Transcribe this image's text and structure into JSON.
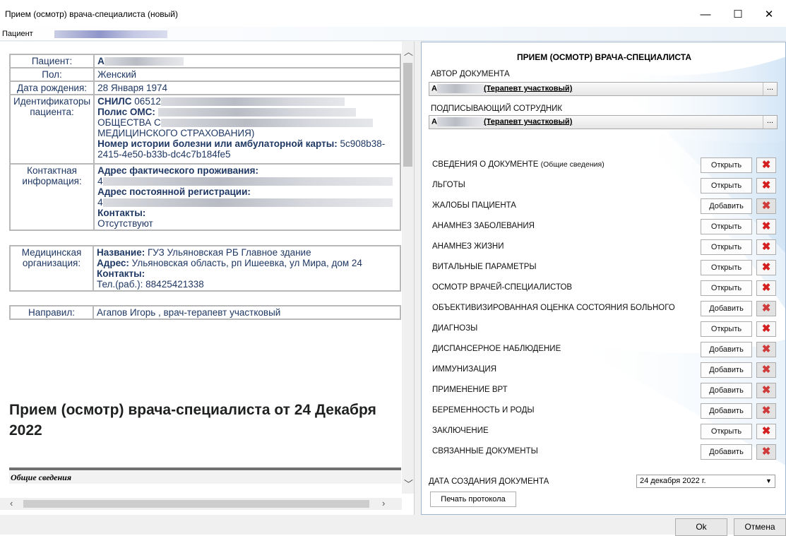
{
  "window": {
    "title": "Прием (осмотр) врача-специалиста (новый)",
    "minimize": "—",
    "maximize": "☐",
    "close": "✕"
  },
  "menu": {
    "patient": "Пациент"
  },
  "patient": {
    "labels": {
      "patient": "Пациент:",
      "sex": "Пол:",
      "dob": "Дата рождения:",
      "ids": "Идентификаторы пациента:",
      "contact": "Контактная информация:"
    },
    "sex": "Женский",
    "dob": "28 Января 1974",
    "snils_label": "СНИЛС",
    "snils_value": "06512",
    "oms_label": "Полис ОМС:",
    "oms_text1": "ОБЩЕСТВА С",
    "oms_text2": "МЕДИЦИНСКОГО СТРАХОВАНИЯ)",
    "history_label": "Номер истории болезни или амбулаторной карты:",
    "history_value1": "5c908b38-",
    "history_value2": "2415-4e50-b33b-dc4c7b184fe5",
    "fact_addr_label": "Адрес фактического проживания:",
    "reg_addr_label": "Адрес постоянной регистрации:",
    "contacts_label": "Контакты:",
    "contacts_value": "Отсутствуют",
    "initial": "А",
    "addr_initial": "4"
  },
  "organization": {
    "label": "Медицинская организация:",
    "name_label": "Название:",
    "name_value": "ГУЗ Ульяновская РБ Главное здание",
    "addr_label": "Адрес:",
    "addr_value": "Ульяновская область, рп Ишеевка, ул Мира, дом 24",
    "contacts_label": "Контакты:",
    "phone": "Тел.(раб.): 88425421338"
  },
  "referral": {
    "label": "Направил:",
    "value": "Агапов Игорь , врач-терапевт участковый"
  },
  "doc_heading": "Прием (осмотр) врача-специалиста от 24 Декабря 2022",
  "section_title": "Общие сведения",
  "panel": {
    "title": "ПРИЕМ (ОСМОТР) ВРАЧА-СПЕЦИАЛИСТА",
    "author_label": "АВТОР ДОКУМЕНТА",
    "author_role": "(Терапевт участковый)",
    "signer_label": "ПОДПИСЫВАЮЩИЙ СОТРУДНИК",
    "signer_role": "(Терапевт участковый)",
    "initial": "А",
    "dots": "...",
    "rows": [
      {
        "label": "СВЕДЕНИЯ О ДОКУМЕНТЕ",
        "note": "(Общие сведения)",
        "action": "Открыть",
        "enabled": true
      },
      {
        "label": "ЛЬГОТЫ",
        "note": "",
        "action": "Открыть",
        "enabled": true
      },
      {
        "label": "ЖАЛОБЫ ПАЦИЕНТА",
        "note": "",
        "action": "Добавить",
        "enabled": false
      },
      {
        "label": "АНАМНЕЗ ЗАБОЛЕВАНИЯ",
        "note": "",
        "action": "Открыть",
        "enabled": true
      },
      {
        "label": "АНАМНЕЗ ЖИЗНИ",
        "note": "",
        "action": "Открыть",
        "enabled": true
      },
      {
        "label": "ВИТАЛЬНЫЕ ПАРАМЕТРЫ",
        "note": "",
        "action": "Открыть",
        "enabled": true
      },
      {
        "label": "ОСМОТР ВРАЧЕЙ-СПЕЦИАЛИСТОВ",
        "note": "",
        "action": "Открыть",
        "enabled": true
      },
      {
        "label": "ОБЪЕКТИВИЗИРОВАННАЯ ОЦЕНКА СОСТОЯНИЯ БОЛЬНОГО",
        "note": "",
        "action": "Добавить",
        "enabled": false
      },
      {
        "label": "ДИАГНОЗЫ",
        "note": "",
        "action": "Открыть",
        "enabled": true
      },
      {
        "label": "ДИСПАНСЕРНОЕ НАБЛЮДЕНИЕ",
        "note": "",
        "action": "Добавить",
        "enabled": false
      },
      {
        "label": "ИММУНИЗАЦИЯ",
        "note": "",
        "action": "Добавить",
        "enabled": false
      },
      {
        "label": "ПРИМЕНЕНИЕ ВРТ",
        "note": "",
        "action": "Добавить",
        "enabled": false
      },
      {
        "label": "БЕРЕМЕННОСТЬ И РОДЫ",
        "note": "",
        "action": "Добавить",
        "enabled": false
      },
      {
        "label": "ЗАКЛЮЧЕНИЕ",
        "note": "",
        "action": "Открыть",
        "enabled": true
      },
      {
        "label": "СВЯЗАННЫЕ ДОКУМЕНТЫ",
        "note": "",
        "action": "Добавить",
        "enabled": false
      }
    ],
    "date_label": "ДАТА СОЗДАНИЯ ДОКУМЕНТА",
    "date_value": "24  декабря  2022 г.",
    "print_button": "Печать протокола"
  },
  "footer": {
    "ok": "Ok",
    "cancel": "Отмена"
  }
}
